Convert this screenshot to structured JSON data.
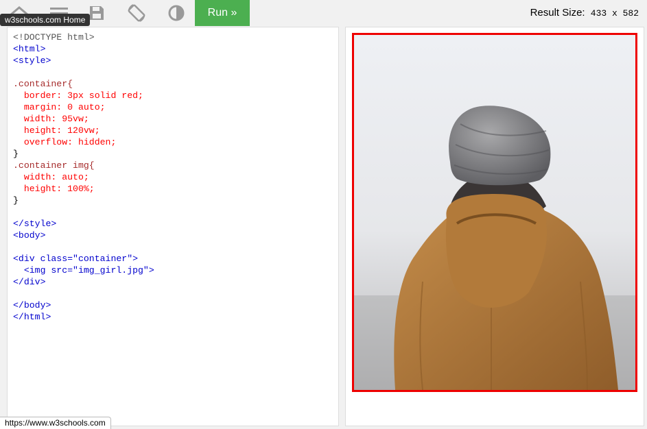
{
  "toolbar": {
    "icons": [
      {
        "name": "home-icon"
      },
      {
        "name": "menu-icon"
      },
      {
        "name": "save-icon"
      },
      {
        "name": "rotate-icon"
      },
      {
        "name": "contrast-icon"
      }
    ],
    "run_label": "Run »",
    "tooltip": "w3schools.com Home",
    "result_size_label": "Result Size:",
    "result_size_value": "433 x 582"
  },
  "editor": {
    "lines": [
      "<!DOCTYPE html>",
      "<html>",
      "<style>",
      "",
      ".container{",
      "  border: 3px solid red;",
      "  margin: 0 auto;",
      "  width: 95vw;",
      "  height: 120vw;",
      "  overflow: hidden;",
      "}",
      ".container img{",
      "  width: auto;",
      "  height: 100%;",
      "}",
      "",
      "</style>",
      "<body>",
      "",
      "<div class=\"container\">",
      "  <img src=\"img_girl.jpg\">",
      "</div>",
      "",
      "</body>",
      "</html>"
    ]
  },
  "result": {
    "image_alt": "Person in knit beanie and brown corduroy jacket seen from behind",
    "colors": {
      "frame_border": "#ee0000",
      "jacket": "#b07a3c",
      "beanie": "#8a8a8a",
      "background": "#eeeef0"
    }
  },
  "status_bar": {
    "url": "https://www.w3schools.com"
  },
  "colors": {
    "run_button": "#4caf50",
    "toolbar_bg": "#f1f1f1"
  }
}
